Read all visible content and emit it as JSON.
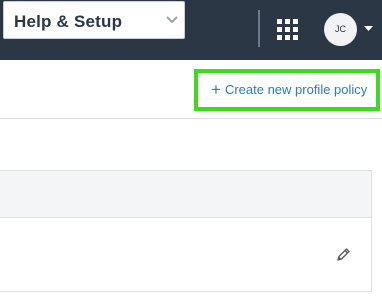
{
  "header": {
    "menu_label": "Help & Setup",
    "menu_icon": "chevron-down-icon",
    "apps_icon": "grid-apps-icon",
    "avatar_initials": "JC",
    "avatar_caret_icon": "caret-down-icon"
  },
  "actions": {
    "create_icon": "plus-icon",
    "create_label": "Create new profile policy"
  },
  "table": {
    "row_action_icon": "pencil-edit-icon"
  },
  "colors": {
    "topbar": "#2b3745",
    "link": "#2e77c9",
    "highlight": "#3ddc1b"
  }
}
